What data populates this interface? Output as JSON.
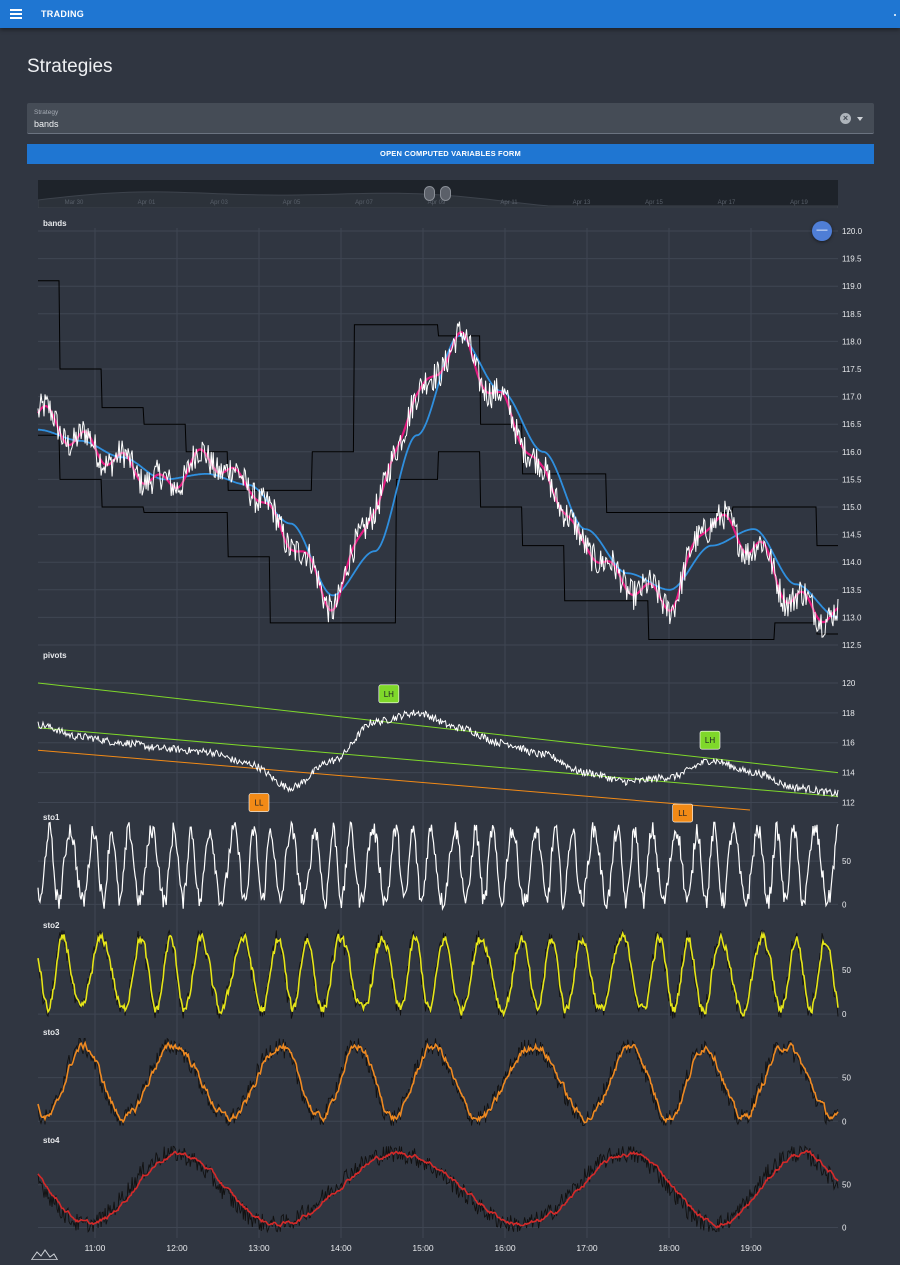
{
  "appbar": {
    "title": "TRADING",
    "menu_icon": "menu-icon"
  },
  "page": {
    "title": "Strategies"
  },
  "strategy": {
    "label": "Strategy",
    "value": "bands"
  },
  "open_button": {
    "label": "OPEN COMPUTED VARIABLES FORM"
  },
  "navigator": {
    "dates": [
      "Mar 30",
      "Apr 01",
      "Apr 03",
      "Apr 05",
      "Apr 07",
      "Apr 09",
      "Apr 11",
      "Apr 13",
      "Apr 15",
      "Apr 17",
      "Apr 19"
    ]
  },
  "zoom_button": {
    "label": "—"
  },
  "colors": {
    "background": "#303641",
    "appbar": "#1f76d2",
    "price": "#ffffff",
    "fast_ma": "#e2197e",
    "slow_ma": "#2f8fde",
    "bands": "#000000",
    "pivot_high": "#7fd82a",
    "pivot_low": "#f28a16",
    "sto2": "#e6e619",
    "sto3": "#ef8a22",
    "sto4": "#d42a2a"
  },
  "chart_data": [
    {
      "type": "line",
      "title": "bands",
      "x": [
        "10:30",
        "11:00",
        "11:30",
        "12:00",
        "12:30",
        "13:00",
        "13:30",
        "14:00",
        "14:30",
        "15:00",
        "15:30",
        "16:00",
        "16:30",
        "17:00",
        "17:30",
        "18:00",
        "18:30",
        "19:00",
        "19:30",
        "19:55"
      ],
      "ylim": [
        112.5,
        120.0
      ],
      "yticks": [
        "112.5",
        "113.0",
        "113.5",
        "114.0",
        "114.5",
        "115.0",
        "115.5",
        "116.0",
        "116.5",
        "117.0",
        "117.5",
        "118.0",
        "118.5",
        "119.0",
        "119.5",
        "120.0"
      ],
      "series": [
        {
          "values": [
            116.8,
            116.3,
            115.8,
            115.5,
            116.0,
            115.6,
            114.3,
            113.2,
            115.2,
            117.1,
            118.2,
            117.0,
            115.6,
            114.2,
            113.6,
            113.2,
            114.9,
            114.2,
            113.2,
            112.9
          ]
        },
        {
          "values": [
            116.7,
            116.2,
            115.8,
            115.4,
            115.9,
            115.4,
            114.4,
            113.3,
            115.0,
            117.0,
            118.0,
            116.9,
            115.6,
            114.3,
            113.6,
            113.3,
            114.8,
            114.3,
            113.3,
            113.0
          ]
        },
        {
          "values": [
            116.4,
            116.2,
            115.9,
            115.5,
            115.6,
            115.4,
            114.7,
            113.4,
            114.2,
            116.3,
            118.1,
            117.1,
            116.0,
            114.6,
            113.8,
            113.5,
            114.3,
            114.6,
            113.6,
            113.0
          ]
        },
        {
          "values": [
            119.1,
            117.5,
            116.8,
            116.5,
            116.0,
            115.3,
            115.3,
            116.0,
            118.3,
            118.3,
            118.1,
            116.5,
            115.6,
            115.6,
            114.9,
            114.9,
            114.9,
            115.0,
            115.0,
            114.3
          ]
        },
        {
          "values": [
            116.3,
            115.5,
            115.0,
            114.9,
            114.9,
            114.1,
            112.9,
            112.9,
            112.9,
            115.5,
            116.0,
            115.0,
            114.3,
            113.3,
            113.3,
            112.6,
            112.6,
            112.6,
            112.9,
            112.7
          ]
        }
      ]
    },
    {
      "type": "line",
      "title": "pivots",
      "ylim": [
        111.5,
        121.0
      ],
      "yticks": [
        "112",
        "114",
        "116",
        "118",
        "120"
      ],
      "series": [
        {
          "values": [
            117.2,
            116.4,
            116.0,
            115.6,
            115.4,
            114.6,
            113.0,
            114.8,
            117.4,
            118.0,
            117.0,
            116.0,
            115.2,
            114.0,
            113.4,
            113.7,
            114.8,
            114.0,
            113.0,
            112.6
          ]
        }
      ],
      "annotations": [
        {
          "label": "LL",
          "x": "13:00",
          "y": 113.0
        },
        {
          "label": "LH",
          "x": "14:35",
          "y": 118.0
        },
        {
          "label": "LL",
          "x": "18:10",
          "y": 112.3
        },
        {
          "label": "LH",
          "x": "18:30",
          "y": 114.9
        }
      ]
    },
    {
      "type": "line",
      "title": "sto1",
      "ylim": [
        -10,
        100
      ],
      "yticks": [
        "0",
        "50"
      ]
    },
    {
      "type": "line",
      "title": "sto2",
      "ylim": [
        -10,
        100
      ],
      "yticks": [
        "0",
        "50"
      ]
    },
    {
      "type": "line",
      "title": "sto3",
      "ylim": [
        -10,
        100
      ],
      "yticks": [
        "0",
        "50"
      ]
    },
    {
      "type": "line",
      "title": "sto4",
      "ylim": [
        -10,
        100
      ],
      "yticks": [
        "0",
        "50"
      ],
      "xticks": [
        "11:00",
        "12:00",
        "13:00",
        "14:00",
        "15:00",
        "16:00",
        "17:00",
        "18:00",
        "19:00"
      ]
    }
  ]
}
